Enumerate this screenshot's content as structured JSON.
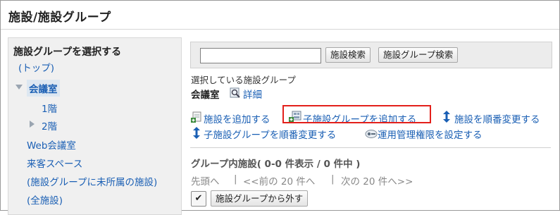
{
  "page": {
    "title": "施設/施設グループ"
  },
  "tree": {
    "heading": "施設グループを選択する",
    "items": [
      {
        "label": "(トップ)"
      },
      {
        "label": "会議室"
      },
      {
        "label": "1階"
      },
      {
        "label": "2階"
      },
      {
        "label": "Web会議室"
      },
      {
        "label": "来客スペース"
      },
      {
        "label": "(施設グループに未所属の施設)"
      },
      {
        "label": "(全施設)"
      }
    ]
  },
  "search": {
    "input_value": "",
    "facility_search_label": "施設検索",
    "group_search_label": "施設グループ検索"
  },
  "selected_group": {
    "caption": "選択している施設グループ",
    "name": "会議室",
    "detail_label": "詳細"
  },
  "actions": {
    "add_facility": "施設を追加する",
    "add_child_group": "子施設グループを追加する",
    "reorder_facilities": "施設を順番変更する",
    "reorder_child_groups": "子施設グループを順番変更する",
    "set_admin_permissions": "運用管理権限を設定する"
  },
  "facilities_in_group": {
    "heading": "グループ内施設( 0-0 件表示 / 0 件中 )",
    "pager": {
      "first": "先頭へ",
      "sep1": "|",
      "prev": "<<前の 20 件へ",
      "sep2": "|",
      "next": "次の 20 件へ>>"
    },
    "checkbox_mark": "✔",
    "remove_button": "施設グループから外す"
  }
}
